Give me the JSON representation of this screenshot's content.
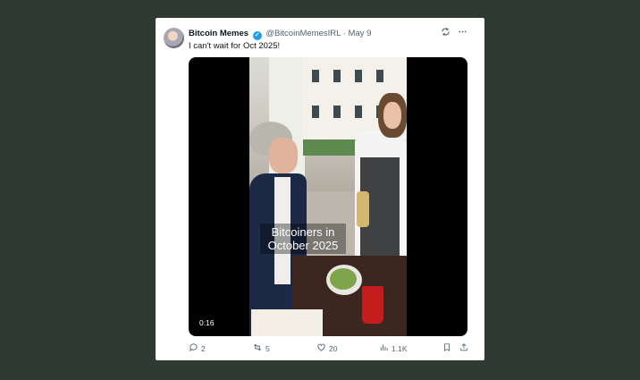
{
  "tweet": {
    "author_name": "Bitcoin Memes",
    "handle": "@BitcoinMemesIRL",
    "separator": "·",
    "date": "May 9",
    "text": "I can't wait for Oct 2025!"
  },
  "video": {
    "caption": "Bitcoiners in October 2025",
    "duration": "0:16"
  },
  "actions": {
    "replies": "2",
    "reposts": "5",
    "likes": "20",
    "views": "1.1K"
  },
  "icons": {
    "verified": "verified-badge-icon",
    "grok": "grok-icon",
    "more": "more-options-icon",
    "reply": "reply-icon",
    "repost": "repost-icon",
    "like": "like-icon",
    "views": "views-icon",
    "bookmark": "bookmark-icon",
    "share": "share-icon"
  },
  "colors": {
    "background": "#2f3a33",
    "card": "#ffffff",
    "verified": "#1d9bf0",
    "text_primary": "#0f1419",
    "text_secondary": "#536471"
  }
}
